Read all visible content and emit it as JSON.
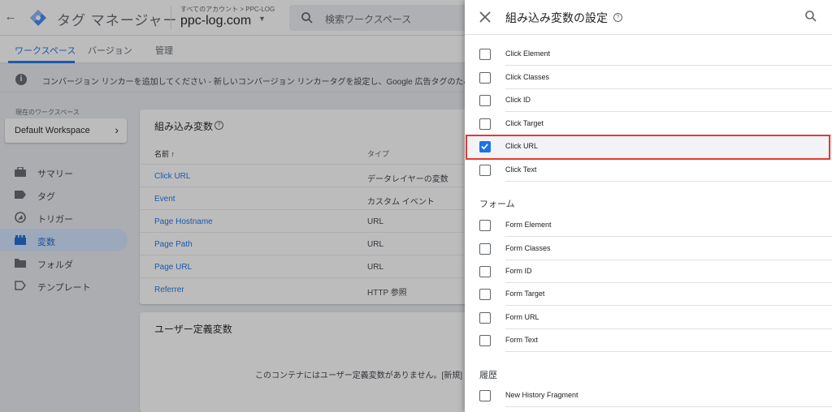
{
  "header": {
    "product_name": "タグ マネージャー",
    "account_breadcrumb": "すべてのアカウント > PPC-LOG",
    "container_name": "ppc-log.com",
    "search_placeholder": "検索ワークスペース"
  },
  "tabs": [
    {
      "label": "ワークスペース",
      "active": true
    },
    {
      "label": "バージョン",
      "active": false
    },
    {
      "label": "管理",
      "active": false
    }
  ],
  "banner": {
    "text": "コンバージョン リンカーを追加してください - 新しいコンバージョン リンカータグを設定し、Google 広告タグのために必"
  },
  "workspace": {
    "label": "現在のワークスペース",
    "name": "Default Workspace"
  },
  "sidebar": {
    "items": [
      {
        "label": "サマリー",
        "icon": "briefcase-icon",
        "active": false
      },
      {
        "label": "タグ",
        "icon": "tag-icon",
        "active": false
      },
      {
        "label": "トリガー",
        "icon": "trigger-icon",
        "active": false
      },
      {
        "label": "変数",
        "icon": "variables-icon",
        "active": true
      },
      {
        "label": "フォルダ",
        "icon": "folder-icon",
        "active": false
      },
      {
        "label": "テンプレート",
        "icon": "template-icon",
        "active": false
      }
    ]
  },
  "builtin_card": {
    "title": "組み込み変数",
    "col_name": "名前 ↑",
    "col_type": "タイプ",
    "rows": [
      {
        "name": "Click URL",
        "type": "データレイヤーの変数"
      },
      {
        "name": "Event",
        "type": "カスタム イベント"
      },
      {
        "name": "Page Hostname",
        "type": "URL"
      },
      {
        "name": "Page Path",
        "type": "URL"
      },
      {
        "name": "Page URL",
        "type": "URL"
      },
      {
        "name": "Referrer",
        "type": "HTTP 参照"
      }
    ]
  },
  "user_card": {
    "title": "ユーザー定義変数",
    "empty_text": "このコンテナにはユーザー定義変数がありません。[新規] を"
  },
  "panel": {
    "title": "組み込み変数の設定",
    "clicks": [
      {
        "label": "Click Element",
        "checked": false
      },
      {
        "label": "Click Classes",
        "checked": false
      },
      {
        "label": "Click ID",
        "checked": false
      },
      {
        "label": "Click Target",
        "checked": false
      },
      {
        "label": "Click URL",
        "checked": true
      },
      {
        "label": "Click Text",
        "checked": false
      }
    ],
    "forms_heading": "フォーム",
    "forms": [
      {
        "label": "Form Element",
        "checked": false
      },
      {
        "label": "Form Classes",
        "checked": false
      },
      {
        "label": "Form ID",
        "checked": false
      },
      {
        "label": "Form Target",
        "checked": false
      },
      {
        "label": "Form URL",
        "checked": false
      },
      {
        "label": "Form Text",
        "checked": false
      }
    ],
    "history_heading": "履歴",
    "history": [
      {
        "label": "New History Fragment",
        "checked": false
      }
    ]
  },
  "colors": {
    "accent": "#1a73e8",
    "highlight_border": "#e53935"
  }
}
